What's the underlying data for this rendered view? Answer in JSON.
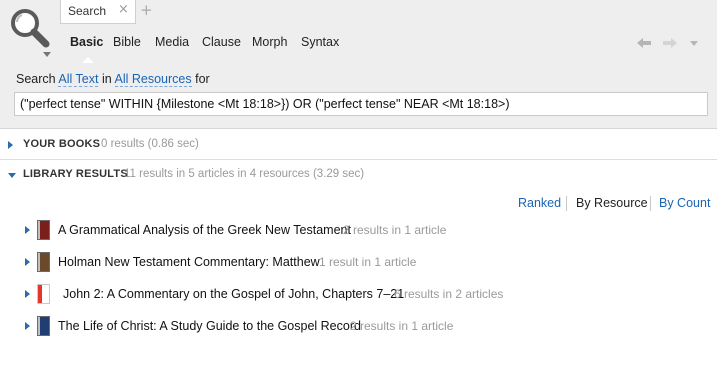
{
  "tab": {
    "label": "Search",
    "close_glyph": "×",
    "add_glyph": "+"
  },
  "mode_nav": [
    "Basic",
    "Bible",
    "Media",
    "Clause",
    "Morph",
    "Syntax"
  ],
  "nav_tools": {
    "back_glyph": "🡐",
    "forward_glyph": "🡒",
    "menu_glyph": "▾"
  },
  "query_line": {
    "prefix": "Search",
    "scope": "All Text",
    "in": "in",
    "resources": "All Resources",
    "suffix": "for"
  },
  "query": {
    "value": "(\"perfect tense\" WITHIN {Milestone <Mt 18:18>}) OR (\"perfect tense\" NEAR <Mt 18:18>)"
  },
  "sections": {
    "your_books": {
      "title": "YOUR BOOKS",
      "meta": "0 results (0.86 sec)"
    },
    "library_results": {
      "title": "LIBRARY RESULTS",
      "meta": "11 results in 5 articles in 4 resources (3.29 sec)"
    }
  },
  "sort_options": [
    "Ranked",
    "By Resource",
    "By Count"
  ],
  "sort_active": "By Resource",
  "results": [
    {
      "title": "A Grammatical Analysis of the Greek New Testament",
      "meta": "2 results in 1 article",
      "cover_color": "#7a1f1a"
    },
    {
      "title": "Holman New Testament Commentary: Matthew",
      "meta": "1 result in 1 article",
      "cover_color": "#6b4a2c"
    },
    {
      "title": "John 2: A Commentary on the Gospel of John, Chapters 7–21",
      "meta": "6 results in 2 articles",
      "cover_color": "#e6352b"
    },
    {
      "title": "The Life of Christ: A Study Guide to the Gospel Record",
      "meta": "2 results in 1 article",
      "cover_color": "#1f3f73"
    }
  ],
  "icons": [
    "search-logo-icon",
    "tab-close-icon",
    "new-tab-icon",
    "back-arrow-icon",
    "forward-arrow-icon",
    "menu-icon",
    "expander-icon",
    "book-cover-icon"
  ],
  "colors": {
    "link": "#1a64b4",
    "panel": "#eeeeee",
    "muted": "#9a9a9a"
  }
}
